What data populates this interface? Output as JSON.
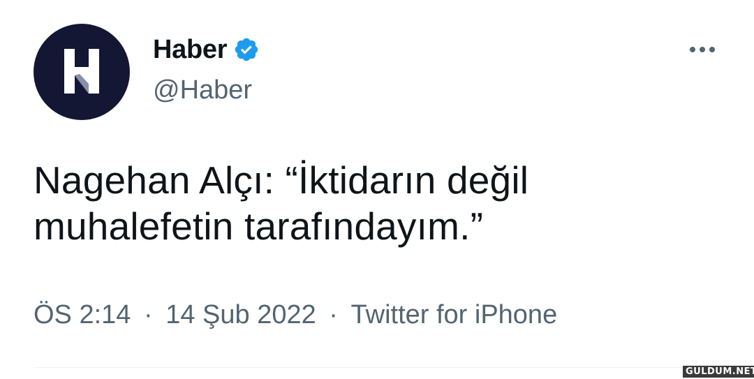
{
  "tweet": {
    "author": {
      "display_name": "Haber",
      "handle": "@Haber",
      "avatar_icon": "haber-logo-icon",
      "verified": true,
      "verified_color": "#1d9bf0"
    },
    "text_lines": [
      "Nagehan Alçı: “İktidarın değil",
      "muhalefetin tarafındayım.”"
    ],
    "meta": {
      "time": "ÖS 2:14",
      "separator": "·",
      "date": "14 Şub 2022",
      "source": "Twitter for iPhone"
    },
    "more_icon": "more-options-icon"
  },
  "watermark": {
    "text": "GULDUM.NET"
  },
  "colors": {
    "text_primary": "#0f1419",
    "text_secondary": "#536471",
    "avatar_bg": "#131733"
  }
}
